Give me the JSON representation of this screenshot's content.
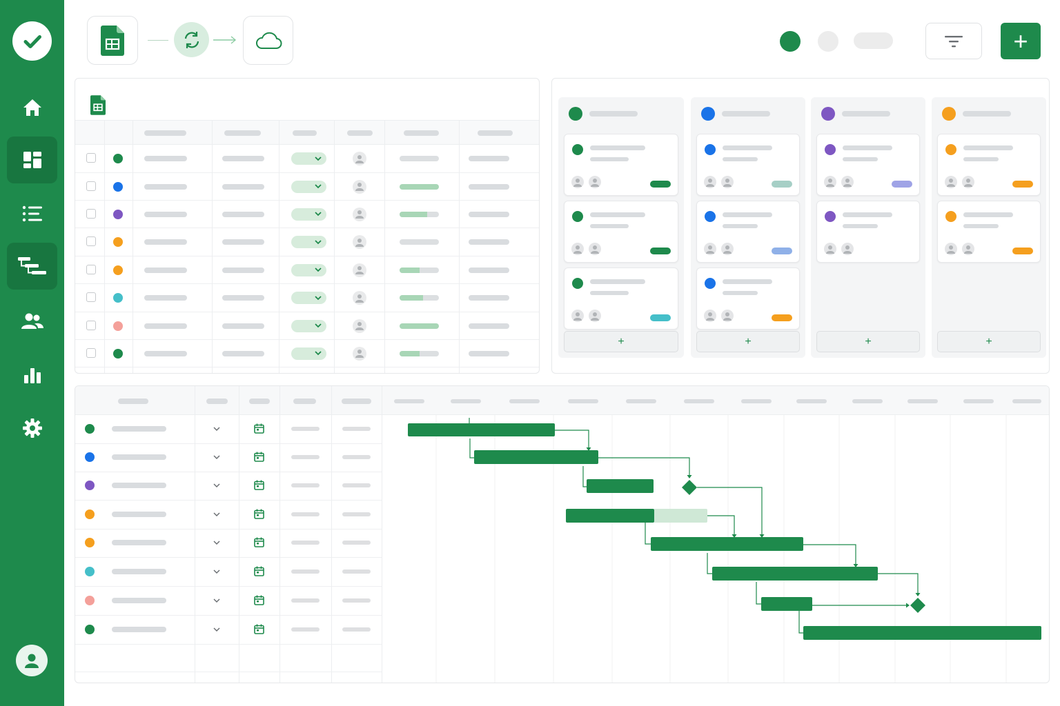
{
  "topbar": {
    "sheets_icon": "sheets-icon",
    "sync_icon": "sync-icon",
    "cloud_icon": "cloud-icon",
    "filter_icon": "filter-icon",
    "add_label": "+"
  },
  "sidebar": {
    "items": [
      {
        "icon": "home-icon"
      },
      {
        "icon": "dashboard-icon",
        "active": true
      },
      {
        "icon": "list-icon"
      },
      {
        "icon": "gantt-icon",
        "active": true
      },
      {
        "icon": "people-icon"
      },
      {
        "icon": "bar-chart-icon"
      },
      {
        "icon": "gear-icon"
      }
    ]
  },
  "kanban": {
    "add_label": "+",
    "columns": [
      {
        "color": "#1e8a4c",
        "cards": [
          {
            "tag": "#1e8a4c"
          },
          {
            "tag": "#1e8a4c"
          },
          {
            "tag": "#45bfc9"
          }
        ]
      },
      {
        "color": "#1a73e8",
        "cards": [
          {
            "tag": "#a6cfc6"
          },
          {
            "tag": "#8fb0e8"
          },
          {
            "tag": "#f59f1e"
          }
        ]
      },
      {
        "color": "#7e57c2",
        "cards": [
          {
            "tag": "#9fa3e6"
          },
          {
            "tag": null
          }
        ]
      },
      {
        "color": "#f59f1e",
        "cards": [
          {
            "tag": "#f59f1e"
          },
          {
            "tag": "#f59f1e"
          }
        ]
      }
    ]
  },
  "grid": {
    "rows": [
      {
        "color": "#1e8a4c",
        "progress": 0.0
      },
      {
        "color": "#1a73e8",
        "progress": 1.0
      },
      {
        "color": "#7e57c2",
        "progress": 0.7
      },
      {
        "color": "#f59f1e",
        "progress": 0.0
      },
      {
        "color": "#f59f1e",
        "progress": 0.5
      },
      {
        "color": "#45bfc9",
        "progress": 0.6
      },
      {
        "color": "#f4a09a",
        "progress": 1.0
      },
      {
        "color": "#1e8a4c",
        "progress": 0.5
      }
    ]
  },
  "gantt": {
    "rows": [
      {
        "color": "#1e8a4c"
      },
      {
        "color": "#1a73e8"
      },
      {
        "color": "#7e57c2"
      },
      {
        "color": "#f59f1e"
      },
      {
        "color": "#f59f1e"
      },
      {
        "color": "#45bfc9"
      },
      {
        "color": "#f4a09a"
      },
      {
        "color": "#1e8a4c"
      }
    ]
  }
}
